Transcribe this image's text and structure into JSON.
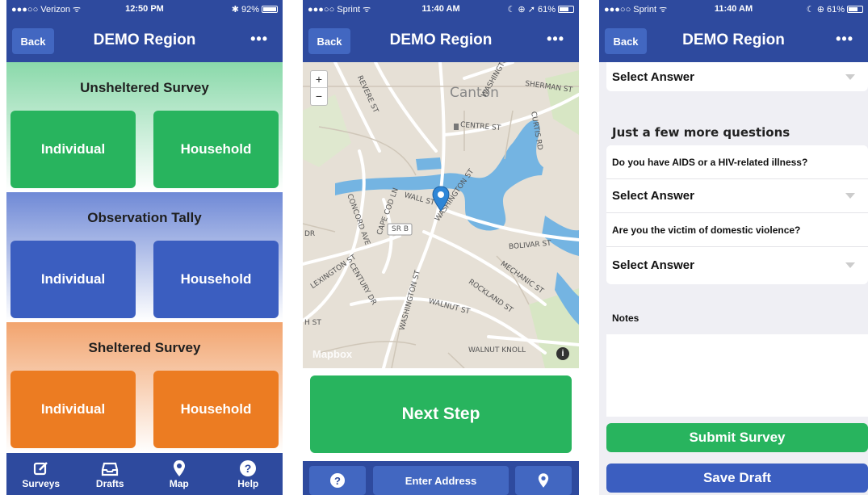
{
  "screen1": {
    "status": {
      "carrier": "●●●○○ Verizon ᯤ",
      "time": "12:50 PM",
      "battery": "✱ 92%"
    },
    "nav": {
      "back": "Back",
      "title": "DEMO Region",
      "more": "•••"
    },
    "sections": [
      {
        "title": "Unsheltered Survey",
        "left": "Individual",
        "right": "Household",
        "color": "#28b45e"
      },
      {
        "title": "Observation Tally",
        "left": "Individual",
        "right": "Household",
        "color": "#3b5ec0"
      },
      {
        "title": "Sheltered Survey",
        "left": "Individual",
        "right": "Household",
        "color": "#ec7c22"
      }
    ],
    "tabs": [
      {
        "label": "Surveys",
        "icon": "edit-icon"
      },
      {
        "label": "Drafts",
        "icon": "inbox-icon"
      },
      {
        "label": "Map",
        "icon": "map-pin-icon"
      },
      {
        "label": "Help",
        "icon": "help-icon"
      }
    ]
  },
  "screen2": {
    "status": {
      "carrier": "●●●○○ Sprint ᯤ",
      "time": "11:40 AM",
      "battery": "☾ ⊕ ➚ 61%"
    },
    "nav": {
      "back": "Back",
      "title": "DEMO Region",
      "more": "•••"
    },
    "map": {
      "zoom_in": "+",
      "zoom_out": "−",
      "labels": {
        "canton": "Canton",
        "sherman": "SHERMAN ST",
        "washington": "WASHINGTON ST",
        "washington2": "WASHINGTON ST",
        "centre": "CENTRE ST",
        "curtis": "CURTIS RD",
        "revere": "REVERE ST",
        "wall": "WALL ST",
        "srb": "SR B",
        "bolivar": "BOLIVAR ST",
        "mechanic": "MECHANIC ST",
        "rockland": "ROCKLAND ST",
        "walnut": "WALNUT ST",
        "walnut_knoll": "WALNUT KNOLL",
        "concord": "CONCORD AVE",
        "capecod": "CAPE COD LN",
        "lexington": "LEXINGTON ST",
        "century": "CENTURY DR",
        "dr": "DR",
        "hst": "H ST"
      },
      "attribution": "Mapbox",
      "info": "i"
    },
    "next_step": "Next Step",
    "bottom": {
      "help": "?",
      "address": "Enter Address",
      "pin": "⚲"
    }
  },
  "screen3": {
    "status": {
      "carrier": "●●●○○ Sprint ᯤ",
      "time": "11:40 AM",
      "battery": "☾ ⊕ 61%"
    },
    "nav": {
      "back": "Back",
      "title": "DEMO Region",
      "more": "•••"
    },
    "first_select": "Select Answer",
    "section_header": "Just a few more questions",
    "questions": [
      {
        "text": "Do you have AIDS or a HIV-related illness?",
        "answer": "Select Answer"
      },
      {
        "text": "Are you the victim of domestic violence?",
        "answer": "Select Answer"
      }
    ],
    "notes_label": "Notes",
    "submit": "Submit Survey",
    "save": "Save Draft",
    "colors": {
      "submit": "#28b45e",
      "save": "#3b5ec0"
    }
  }
}
